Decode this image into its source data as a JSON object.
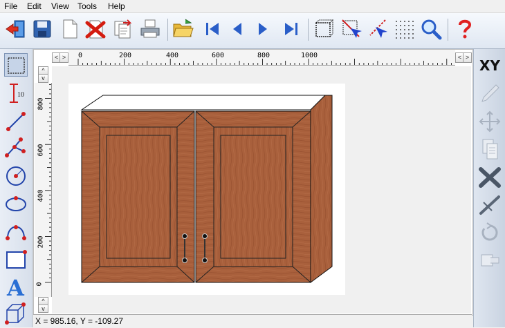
{
  "menu": {
    "items": [
      "File",
      "Edit",
      "View",
      "Tools",
      "Help"
    ]
  },
  "toolbar": {
    "buttons": [
      "exit-icon",
      "save-icon",
      "new-document-icon",
      "delete-icon",
      "export-icon",
      "print-icon",
      "open-folder-icon",
      "first-page-icon",
      "previous-page-icon",
      "next-page-icon",
      "last-page-icon",
      "frame-icon",
      "select-cross-icon",
      "select-arrow-icon",
      "grid-icon",
      "zoom-icon",
      "help-icon"
    ]
  },
  "left_tools": [
    "select-rect-icon",
    "dimension-icon",
    "line-icon",
    "polyline-icon",
    "circle-icon",
    "ellipse-icon",
    "arc-icon",
    "rectangle-icon",
    "text-icon",
    "box-3d-icon"
  ],
  "right_tools": {
    "xy_label": "XY",
    "items": [
      "pencil-icon",
      "move-icon",
      "copy-icon",
      "mirror-icon",
      "trim-icon",
      "rotate-icon",
      "stamp-icon"
    ]
  },
  "ruler": {
    "horizontal": [
      "0",
      "200",
      "400",
      "600",
      "800",
      "1000"
    ],
    "vertical": [
      "800",
      "600",
      "400",
      "200",
      "0"
    ]
  },
  "status": {
    "coords": "X = 985.16, Y = -109.27"
  },
  "colors": {
    "wood": "#a9603c",
    "wood_dark": "#7b4526",
    "accent": "#2244cc"
  }
}
